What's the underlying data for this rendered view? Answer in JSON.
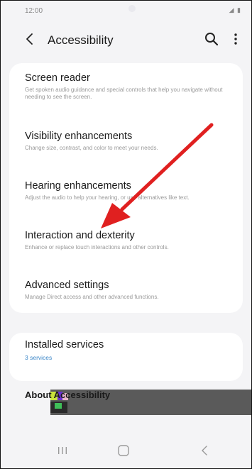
{
  "status_bar": {
    "time": "12:00",
    "icons": "◢ ▮"
  },
  "app_bar": {
    "title": "Accessibility",
    "back_icon": "chevron-left-icon",
    "search_icon": "search-icon",
    "more_icon": "more-vert-icon"
  },
  "menu": {
    "items": [
      {
        "title": "Screen reader",
        "description": "Get spoken audio guidance and special controls that help you navigate without needing to see the screen."
      },
      {
        "title": "Visibility enhancements",
        "description": "Change size, contrast, and color to meet your needs."
      },
      {
        "title": "Hearing enhancements",
        "description": "Adjust the audio to help your hearing, or use alternatives like text."
      },
      {
        "title": "Interaction and dexterity",
        "description": "Enhance or replace touch interactions and other controls."
      },
      {
        "title": "Advanced settings",
        "description": "Manage Direct access and other advanced functions."
      }
    ]
  },
  "services": {
    "title": "Installed services",
    "subtitle": "3 services"
  },
  "about": {
    "label": "About Accessibility"
  },
  "nav_bar": {
    "recents_icon": "recents-icon",
    "home_icon": "home-icon",
    "back_icon": "back-icon"
  },
  "annotation": {
    "arrow_color": "#e02020"
  }
}
